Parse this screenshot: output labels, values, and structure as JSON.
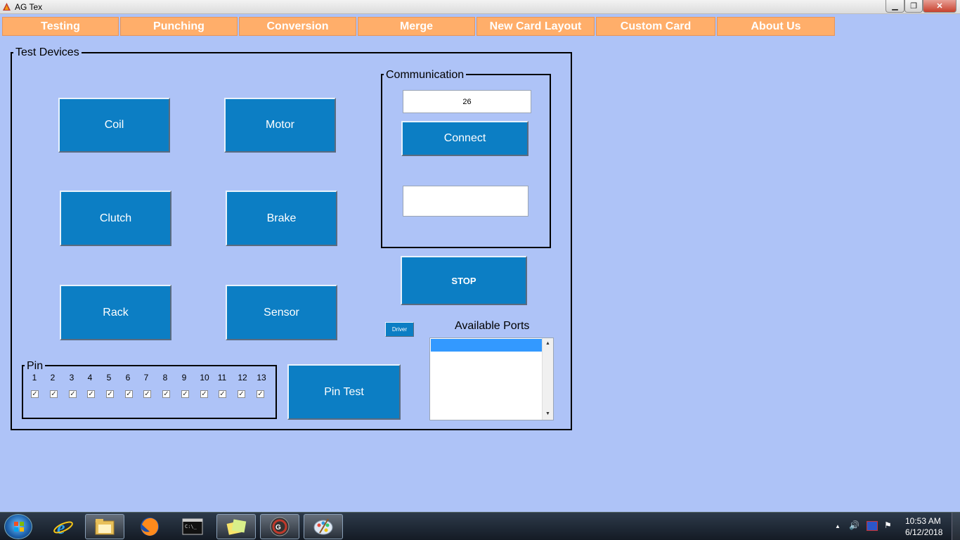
{
  "window": {
    "title": "AG Tex",
    "min_glyph": "▁",
    "max_glyph": "❐",
    "close_glyph": "✕"
  },
  "menu": [
    "Testing",
    "Punching",
    "Conversion",
    "Merge",
    "New Card Layout",
    "Custom Card",
    "About Us"
  ],
  "test_devices": {
    "title": "Test Devices",
    "buttons": {
      "coil": "Coil",
      "motor": "Motor",
      "clutch": "Clutch",
      "brake": "Brake",
      "rack": "Rack",
      "sensor": "Sensor"
    }
  },
  "communication": {
    "title": "Communication",
    "port_value": "26",
    "connect_label": "Connect",
    "status_text": ""
  },
  "stop_label": "STOP",
  "driver_label": "Driver",
  "available_ports": {
    "label": "Available Ports",
    "items": [
      ""
    ],
    "selected_index": 0
  },
  "pin": {
    "title": "Pin",
    "numbers": [
      "1",
      "2",
      "3",
      "4",
      "5",
      "6",
      "7",
      "8",
      "9",
      "10",
      "11",
      "12",
      "13"
    ],
    "checked": [
      true,
      true,
      true,
      true,
      true,
      true,
      true,
      true,
      true,
      true,
      true,
      true,
      true
    ],
    "check_glyph": "✓"
  },
  "pin_test_label": "Pin Test",
  "taskbar": {
    "apps": [
      "internet-explorer",
      "file-explorer",
      "firefox",
      "command-prompt",
      "sticky-notes",
      "ag-tex",
      "paint"
    ],
    "active_app": "ag-tex",
    "time": "10:53 AM",
    "date": "6/12/2018",
    "tray_up_glyph": "▲",
    "tray_volume_glyph": "🔊",
    "tray_flag_glyph": "⚑"
  },
  "colors": {
    "background": "#aec3f7",
    "menu_tab": "#ffae6a",
    "button_blue": "#0c7ec4",
    "list_selection": "#3399ff"
  }
}
